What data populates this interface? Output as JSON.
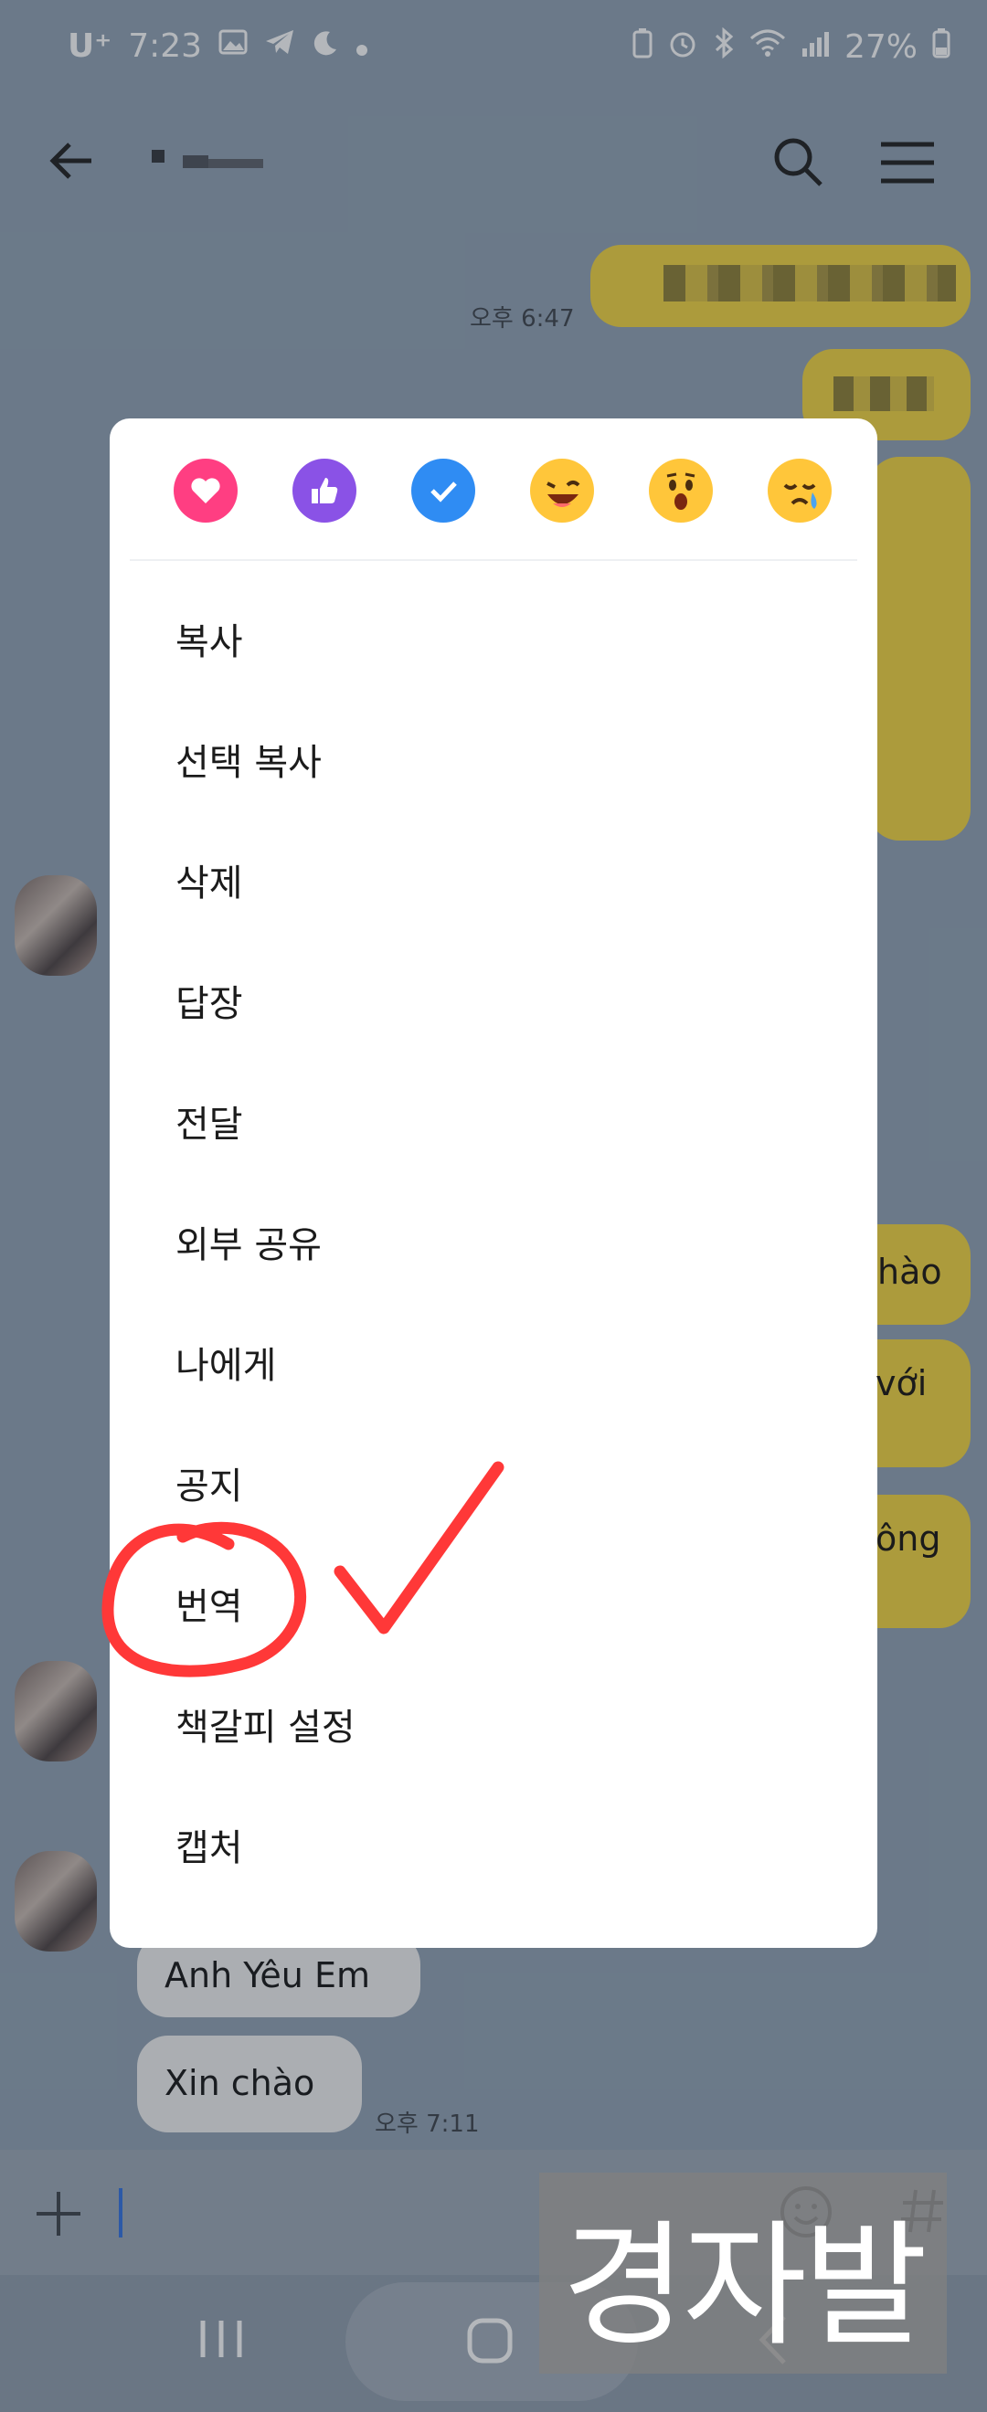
{
  "status_bar": {
    "carrier": "U⁺",
    "time": "7:23",
    "battery": "27%"
  },
  "chat": {
    "times": [
      "오후 6:47",
      "오후 7:11"
    ],
    "partial_right_messages": [
      "hào",
      "với",
      "ông"
    ],
    "received_messages": [
      "Anh Yêu Em",
      "Xin chào"
    ]
  },
  "context_menu": {
    "reactions": [
      "heart-icon",
      "thumbs-up-icon",
      "check-icon",
      "grinning-face-icon",
      "surprised-face-icon",
      "sad-tear-face-icon"
    ],
    "items": [
      "복사",
      "선택 복사",
      "삭제",
      "답장",
      "전달",
      "외부 공유",
      "나에게",
      "공지",
      "번역",
      "책갈피 설정",
      "캡처"
    ]
  },
  "watermark": {
    "text": "경자발"
  },
  "colors": {
    "accent_yellow": "#f3d43c",
    "annotation_red": "#ff3838",
    "heart_pink": "#ff3e82",
    "like_purple": "#8a52e6",
    "check_blue": "#2f8cf3"
  }
}
